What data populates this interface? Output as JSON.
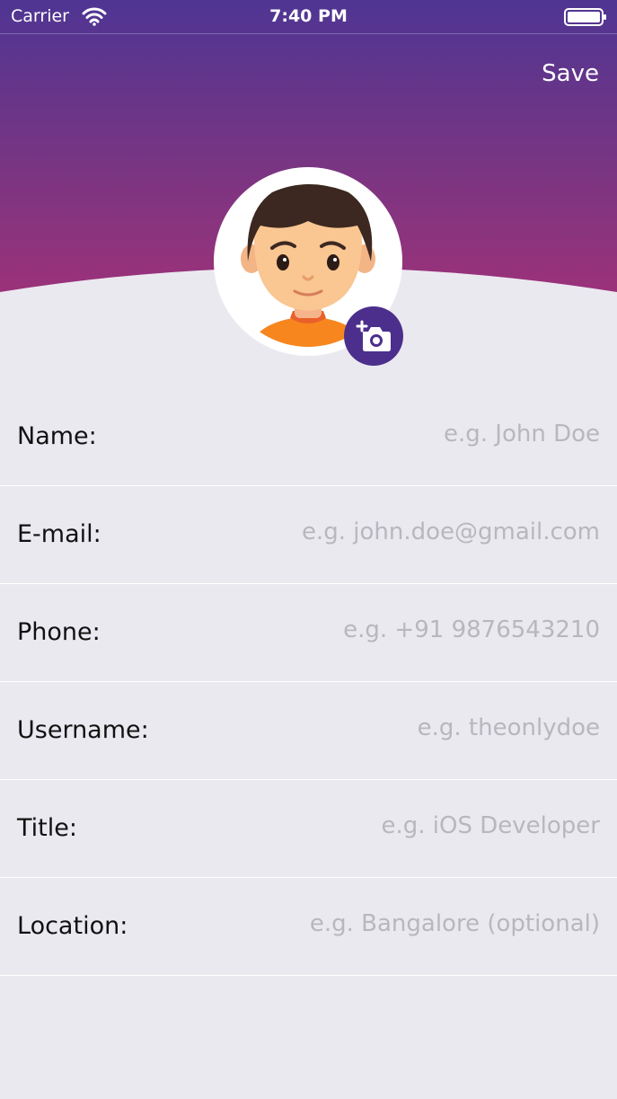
{
  "status_bar": {
    "carrier": "Carrier",
    "time": "7:40 PM",
    "wifi_icon": "wifi-icon",
    "battery_icon": "battery-icon"
  },
  "header": {
    "save_label": "Save",
    "gradient_top": "#4f3593",
    "gradient_bottom": "#b23074"
  },
  "avatar": {
    "icon": "avatar-boy-icon",
    "camera_icon": "add-camera-icon",
    "camera_color": "#4c2f8c"
  },
  "form": {
    "rows": [
      {
        "label": "Name:",
        "value": "",
        "placeholder": "e.g. John Doe"
      },
      {
        "label": "E-mail:",
        "value": "",
        "placeholder": "e.g. john.doe@gmail.com"
      },
      {
        "label": "Phone:",
        "value": "",
        "placeholder": "e.g. +91 9876543210"
      },
      {
        "label": "Username:",
        "value": "",
        "placeholder": "e.g. theonlydoe"
      },
      {
        "label": "Title:",
        "value": "",
        "placeholder": "e.g. iOS Developer"
      },
      {
        "label": "Location:",
        "value": "",
        "placeholder": "e.g. Bangalore (optional)"
      }
    ]
  }
}
